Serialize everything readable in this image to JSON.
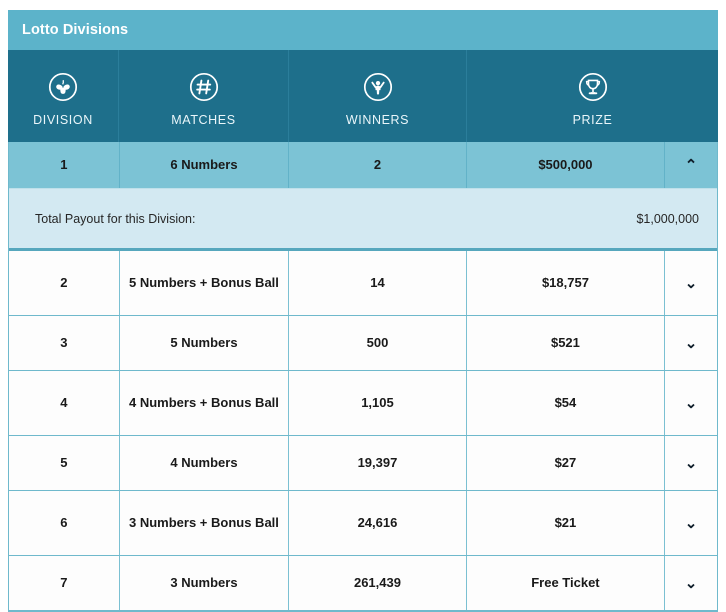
{
  "widget": {
    "title": "Lotto Divisions"
  },
  "colors": {
    "title_bar": "#5cb3ca",
    "header_bar": "#1e6f8b",
    "active_row": "#7cc3d5",
    "payout_panel": "#d3e9f2",
    "row_background": "#fdfdfd",
    "border": "#6fb9cc"
  },
  "columns": [
    {
      "label": "DIVISION",
      "icon": "clover-icon"
    },
    {
      "label": "MATCHES",
      "icon": "hash-icon"
    },
    {
      "label": "WINNERS",
      "icon": "winner-person-icon"
    },
    {
      "label": "PRIZE",
      "icon": "trophy-icon"
    }
  ],
  "expanded_row": {
    "division": "1",
    "matches": "6 Numbers",
    "winners": "2",
    "prize": "$500,000",
    "chevron": "⌃",
    "payout_label": "Total Payout for this Division:",
    "payout_value": "$1,000,000"
  },
  "rows": [
    {
      "division": "2",
      "matches": "5 Numbers + Bonus Ball",
      "winners": "14",
      "prize": "$18,757",
      "chevron": "⌄"
    },
    {
      "division": "3",
      "matches": "5 Numbers",
      "winners": "500",
      "prize": "$521",
      "chevron": "⌄"
    },
    {
      "division": "4",
      "matches": "4 Numbers + Bonus Ball",
      "winners": "1,105",
      "prize": "$54",
      "chevron": "⌄"
    },
    {
      "division": "5",
      "matches": "4 Numbers",
      "winners": "19,397",
      "prize": "$27",
      "chevron": "⌄"
    },
    {
      "division": "6",
      "matches": "3 Numbers + Bonus Ball",
      "winners": "24,616",
      "prize": "$21",
      "chevron": "⌄"
    },
    {
      "division": "7",
      "matches": "3 Numbers",
      "winners": "261,439",
      "prize": "Free Ticket",
      "chevron": "⌄"
    }
  ]
}
